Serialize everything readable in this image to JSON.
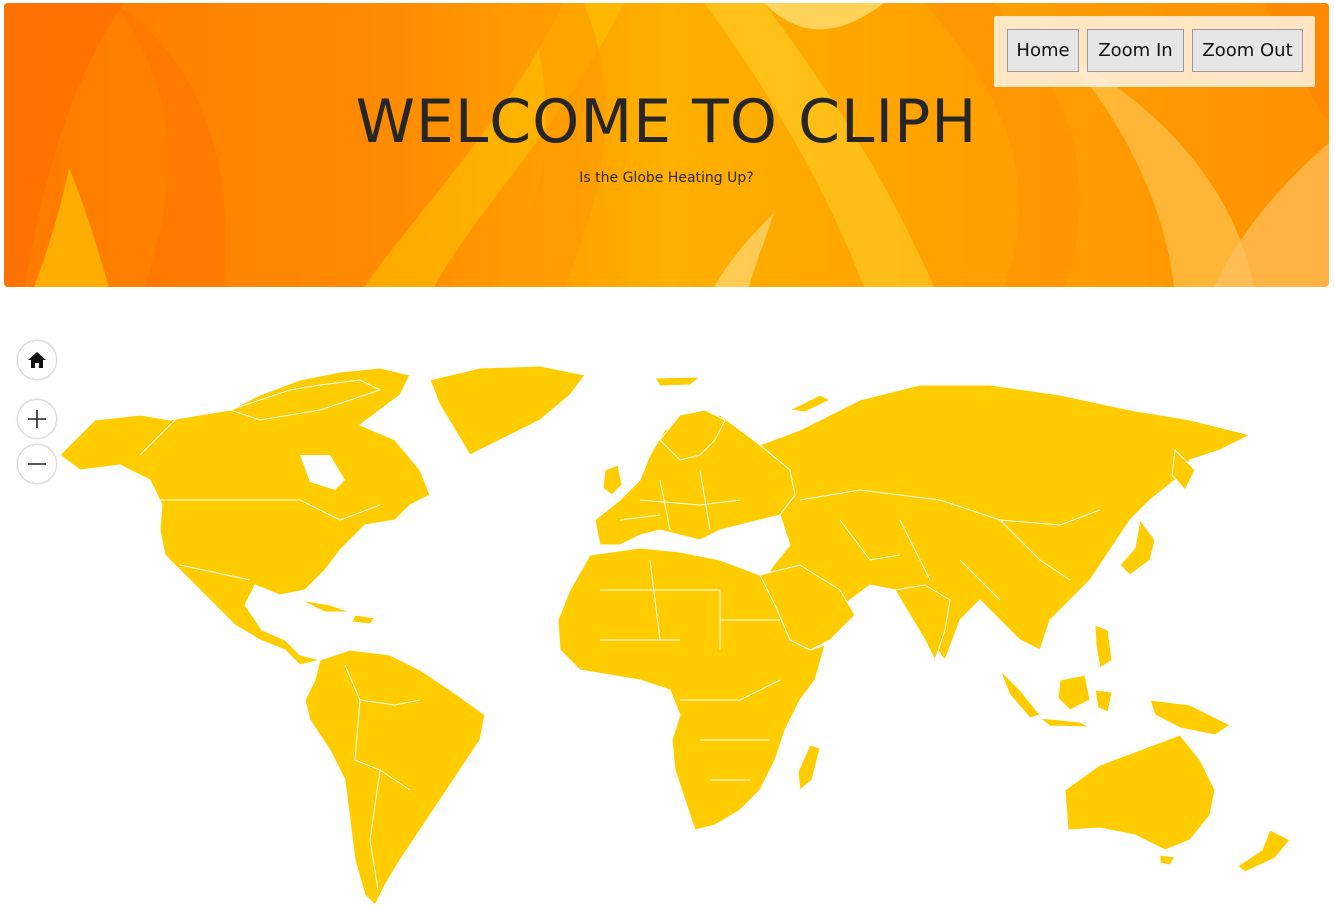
{
  "header": {
    "title": "WELCOME TO CLIPH",
    "subtitle": "Is the Globe Heating Up?"
  },
  "toolbar": {
    "home_label": "Home",
    "zoom_in_label": "Zoom In",
    "zoom_out_label": "Zoom Out"
  },
  "map": {
    "land_color": "#ffcc00",
    "border_color": "#ffffff",
    "controls": {
      "home_icon": "home-icon",
      "zoom_in_icon": "plus-icon",
      "zoom_out_icon": "minus-icon"
    }
  },
  "colors": {
    "header_orange": "#ff8c00",
    "header_yellow": "#ffb000",
    "title_text": "#262626"
  }
}
